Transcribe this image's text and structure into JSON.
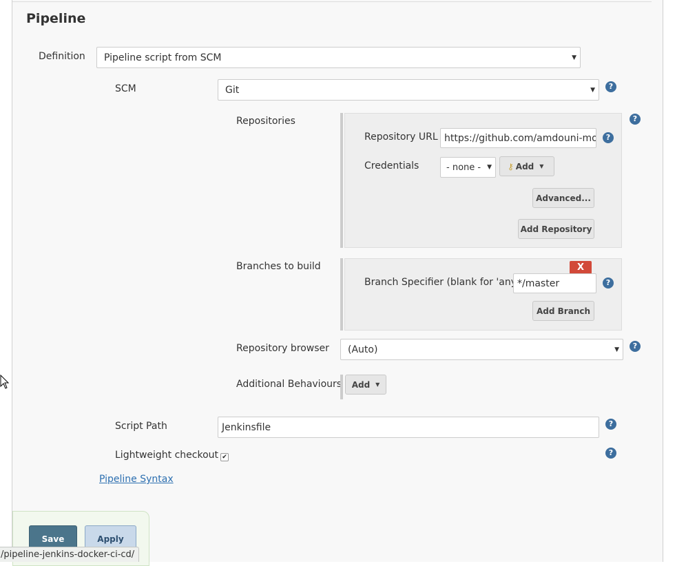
{
  "section_title": "Pipeline",
  "definition": {
    "label": "Definition",
    "value": "Pipeline script from SCM"
  },
  "scm": {
    "label": "SCM",
    "value": "Git"
  },
  "repositories": {
    "label": "Repositories",
    "url_label": "Repository URL",
    "url_value": "https://github.com/amdouni-mohamed/pipeline-jenkins-docker-ci-cd",
    "credentials_label": "Credentials",
    "credentials_value": "- none -",
    "add_label": "Add",
    "advanced_label": "Advanced...",
    "add_repository_label": "Add Repository"
  },
  "branches": {
    "label": "Branches to build",
    "delete_label": "X",
    "specifier_label": "Branch Specifier (blank for 'any')",
    "specifier_value": "*/master",
    "add_branch_label": "Add Branch"
  },
  "repository_browser": {
    "label": "Repository browser",
    "value": "(Auto)"
  },
  "additional_behaviours": {
    "label": "Additional Behaviours",
    "add_label": "Add"
  },
  "script_path": {
    "label": "Script Path",
    "value": "Jenkinsfile"
  },
  "lightweight_checkout": {
    "label": "Lightweight checkout",
    "checked": true
  },
  "pipeline_syntax_link": "Pipeline Syntax",
  "buttons": {
    "save": "Save",
    "apply": "Apply"
  },
  "status_url": "/pipeline-jenkins-docker-ci-cd/",
  "icons": {
    "help": "question-circle-icon",
    "dropdown": "chevron-down-icon",
    "key": "key-icon",
    "cursor": "mouse-pointer-icon"
  },
  "colors": {
    "help_icon": "#3d6e9e",
    "delete_button": "#d24939",
    "save_button": "#4b758b",
    "apply_button": "#c9d9ea",
    "link": "#2c6fb0"
  }
}
